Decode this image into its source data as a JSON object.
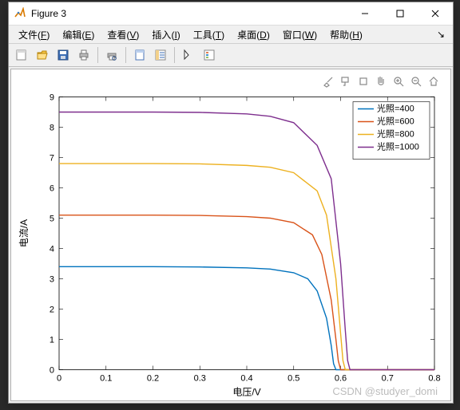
{
  "title": "Figure 3",
  "menus": {
    "file": {
      "label": "文件",
      "key": "F"
    },
    "edit": {
      "label": "编辑",
      "key": "E"
    },
    "view": {
      "label": "查看",
      "key": "V"
    },
    "insert": {
      "label": "插入",
      "key": "I"
    },
    "tools": {
      "label": "工具",
      "key": "T"
    },
    "desktop": {
      "label": "桌面",
      "key": "D"
    },
    "window": {
      "label": "窗口",
      "key": "W"
    },
    "help": {
      "label": "帮助",
      "key": "H"
    }
  },
  "watermark": "CSDN @studyer_domi",
  "chart_data": {
    "type": "line",
    "xlabel": "电压/V",
    "ylabel": "电流/A",
    "xlim": [
      0,
      0.8
    ],
    "ylim": [
      0,
      9
    ],
    "xticks": [
      0,
      0.1,
      0.2,
      0.3,
      0.4,
      0.5,
      0.6,
      0.7,
      0.8
    ],
    "yticks": [
      0,
      1,
      2,
      3,
      4,
      5,
      6,
      7,
      8,
      9
    ],
    "legend_title_prefix": "光照=",
    "colors": {
      "400": "#0072BD",
      "600": "#D95319",
      "800": "#EDB120",
      "1000": "#7E2F8E"
    },
    "series": [
      {
        "name": "光照=400",
        "G": 400,
        "x": [
          0,
          0.1,
          0.2,
          0.3,
          0.4,
          0.45,
          0.5,
          0.53,
          0.55,
          0.57,
          0.58,
          0.585,
          0.59,
          0.8
        ],
        "y": [
          3.4,
          3.4,
          3.4,
          3.39,
          3.36,
          3.32,
          3.2,
          3.0,
          2.6,
          1.7,
          0.8,
          0.2,
          0.0,
          0.0
        ]
      },
      {
        "name": "光照=600",
        "G": 600,
        "x": [
          0,
          0.1,
          0.2,
          0.3,
          0.4,
          0.45,
          0.5,
          0.54,
          0.56,
          0.58,
          0.59,
          0.595,
          0.6,
          0.8
        ],
        "y": [
          5.1,
          5.1,
          5.1,
          5.09,
          5.05,
          5.0,
          4.85,
          4.45,
          3.8,
          2.3,
          1.0,
          0.3,
          0.0,
          0.0
        ]
      },
      {
        "name": "光照=800",
        "G": 800,
        "x": [
          0,
          0.1,
          0.2,
          0.3,
          0.4,
          0.45,
          0.5,
          0.55,
          0.57,
          0.59,
          0.6,
          0.605,
          0.61,
          0.8
        ],
        "y": [
          6.8,
          6.8,
          6.8,
          6.79,
          6.74,
          6.68,
          6.5,
          5.9,
          5.1,
          3.0,
          1.2,
          0.3,
          0.0,
          0.0
        ]
      },
      {
        "name": "光照=1000",
        "G": 1000,
        "x": [
          0,
          0.1,
          0.2,
          0.3,
          0.4,
          0.45,
          0.5,
          0.55,
          0.58,
          0.6,
          0.61,
          0.615,
          0.62,
          0.8
        ],
        "y": [
          8.5,
          8.5,
          8.5,
          8.49,
          8.44,
          8.36,
          8.15,
          7.4,
          6.3,
          3.5,
          1.3,
          0.3,
          0.0,
          0.0
        ]
      }
    ]
  }
}
